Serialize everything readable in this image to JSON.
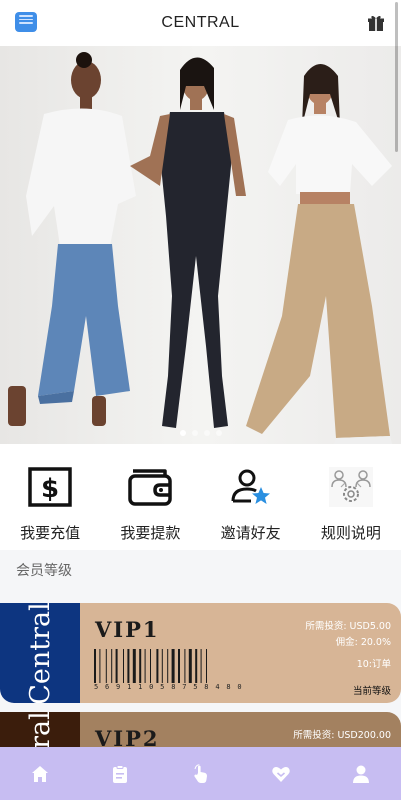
{
  "header": {
    "title": "CENTRAL",
    "logo_icon": "app-logo-icon",
    "gift_icon": "gift-icon"
  },
  "banner": {
    "slides": 4,
    "active_index": 0
  },
  "actions": [
    {
      "label": "我要充值",
      "icon": "dollar-icon"
    },
    {
      "label": "我要提款",
      "icon": "wallet-icon"
    },
    {
      "label": "邀请好友",
      "icon": "invite-user-icon"
    },
    {
      "label": "规则说明",
      "icon": "rules-icon"
    }
  ],
  "section": {
    "title": "会员等级"
  },
  "vip_cards": [
    {
      "brand": "Central",
      "level": "VIP1",
      "barcode_number": "5 6 9 1 1 0 5   8 7 5 8 4 8 0",
      "required_label": "所需投资:",
      "required_value": "USD5.00",
      "commission_label": "佣金:",
      "commission_value": "20.0%",
      "orders": "10:订单",
      "current_label": "当前等级",
      "side_color": "#0d3580",
      "body_color": "#d7b596"
    },
    {
      "brand": "Central",
      "level": "VIP2",
      "required_label": "所需投资:",
      "required_value": "USD200.00",
      "side_color": "#3b1d0c",
      "body_color": "#a38160"
    }
  ],
  "tabbar": {
    "items": [
      {
        "icon": "home-icon"
      },
      {
        "icon": "orders-clipboard-icon"
      },
      {
        "icon": "tap-hand-icon"
      },
      {
        "icon": "vip-heart-icon"
      },
      {
        "icon": "profile-icon"
      }
    ],
    "background": "#c7bdf2"
  }
}
